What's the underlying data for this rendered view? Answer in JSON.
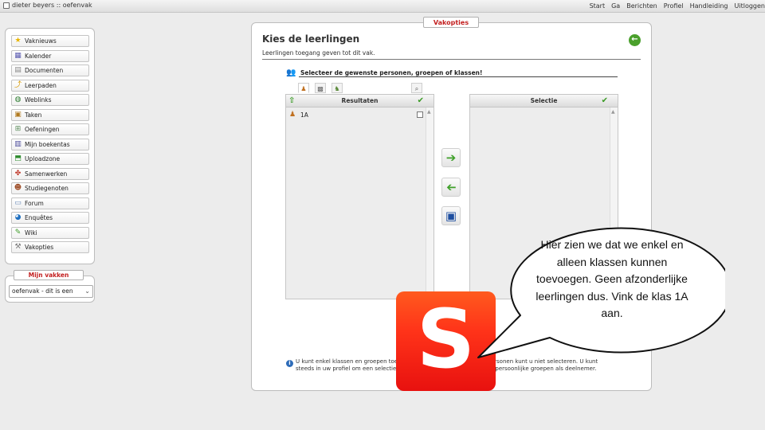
{
  "app": {
    "title": "dieter beyers :: oefenvak",
    "icon": "window-icon"
  },
  "top_nav": [
    "Start",
    "Ga",
    "Berichten",
    "Profiel",
    "Handleiding",
    "Uitloggen"
  ],
  "sidebar": {
    "items": [
      {
        "label": "Vaknieuws",
        "icon": "star-icon"
      },
      {
        "label": "Kalender",
        "icon": "calendar-icon"
      },
      {
        "label": "Documenten",
        "icon": "document-icon"
      },
      {
        "label": "Leerpaden",
        "icon": "path-icon"
      },
      {
        "label": "Weblinks",
        "icon": "globe-link-icon"
      },
      {
        "label": "Taken",
        "icon": "tasks-icon"
      },
      {
        "label": "Oefeningen",
        "icon": "exercise-icon"
      },
      {
        "label": "Mijn boekentas",
        "icon": "bookbag-icon"
      },
      {
        "label": "Uploadzone",
        "icon": "upload-icon"
      },
      {
        "label": "Samenwerken",
        "icon": "collaborate-icon"
      },
      {
        "label": "Studiegenoten",
        "icon": "classmates-icon"
      },
      {
        "label": "Forum",
        "icon": "forum-icon"
      },
      {
        "label": "Enquêtes",
        "icon": "survey-icon"
      },
      {
        "label": "Wiki",
        "icon": "wiki-icon"
      },
      {
        "label": "Vakopties",
        "icon": "wrench-icon"
      }
    ]
  },
  "mijn_vakken": {
    "title": "Mijn vakken",
    "selected": "oefenvak - dit is een"
  },
  "main": {
    "tab_label": "Vakopties",
    "title": "Kies de leerlingen",
    "subtitle": "Leerlingen toegang geven tot dit vak.",
    "select_heading": "Selecteer de gewenste personen, groepen of klassen!",
    "results_header": "Resultaten",
    "selection_header": "Selectie",
    "results": [
      {
        "label": "1A",
        "icon": "class-group-icon",
        "checked": false
      }
    ],
    "info_text": "U kunt enkel klassen en groepen toevoegen aan dit vak. Individuele personen kunt u niet selecteren. U kunt steeds in uw profiel om een selectie van leerlingen te groeperen. Deze persoonlijke groepen als deelnemer."
  },
  "bubble": {
    "text": "Hier zien we dat we enkel en alleen klassen kunnen toevoegen. Geen afzonderlijke leerlingen dus. Vink de klas 1A aan."
  },
  "logo": {
    "letter": "S",
    "color": "#ff3a1a"
  },
  "colors": {
    "accent_red": "#c32020",
    "success_green": "#3a9a25"
  }
}
